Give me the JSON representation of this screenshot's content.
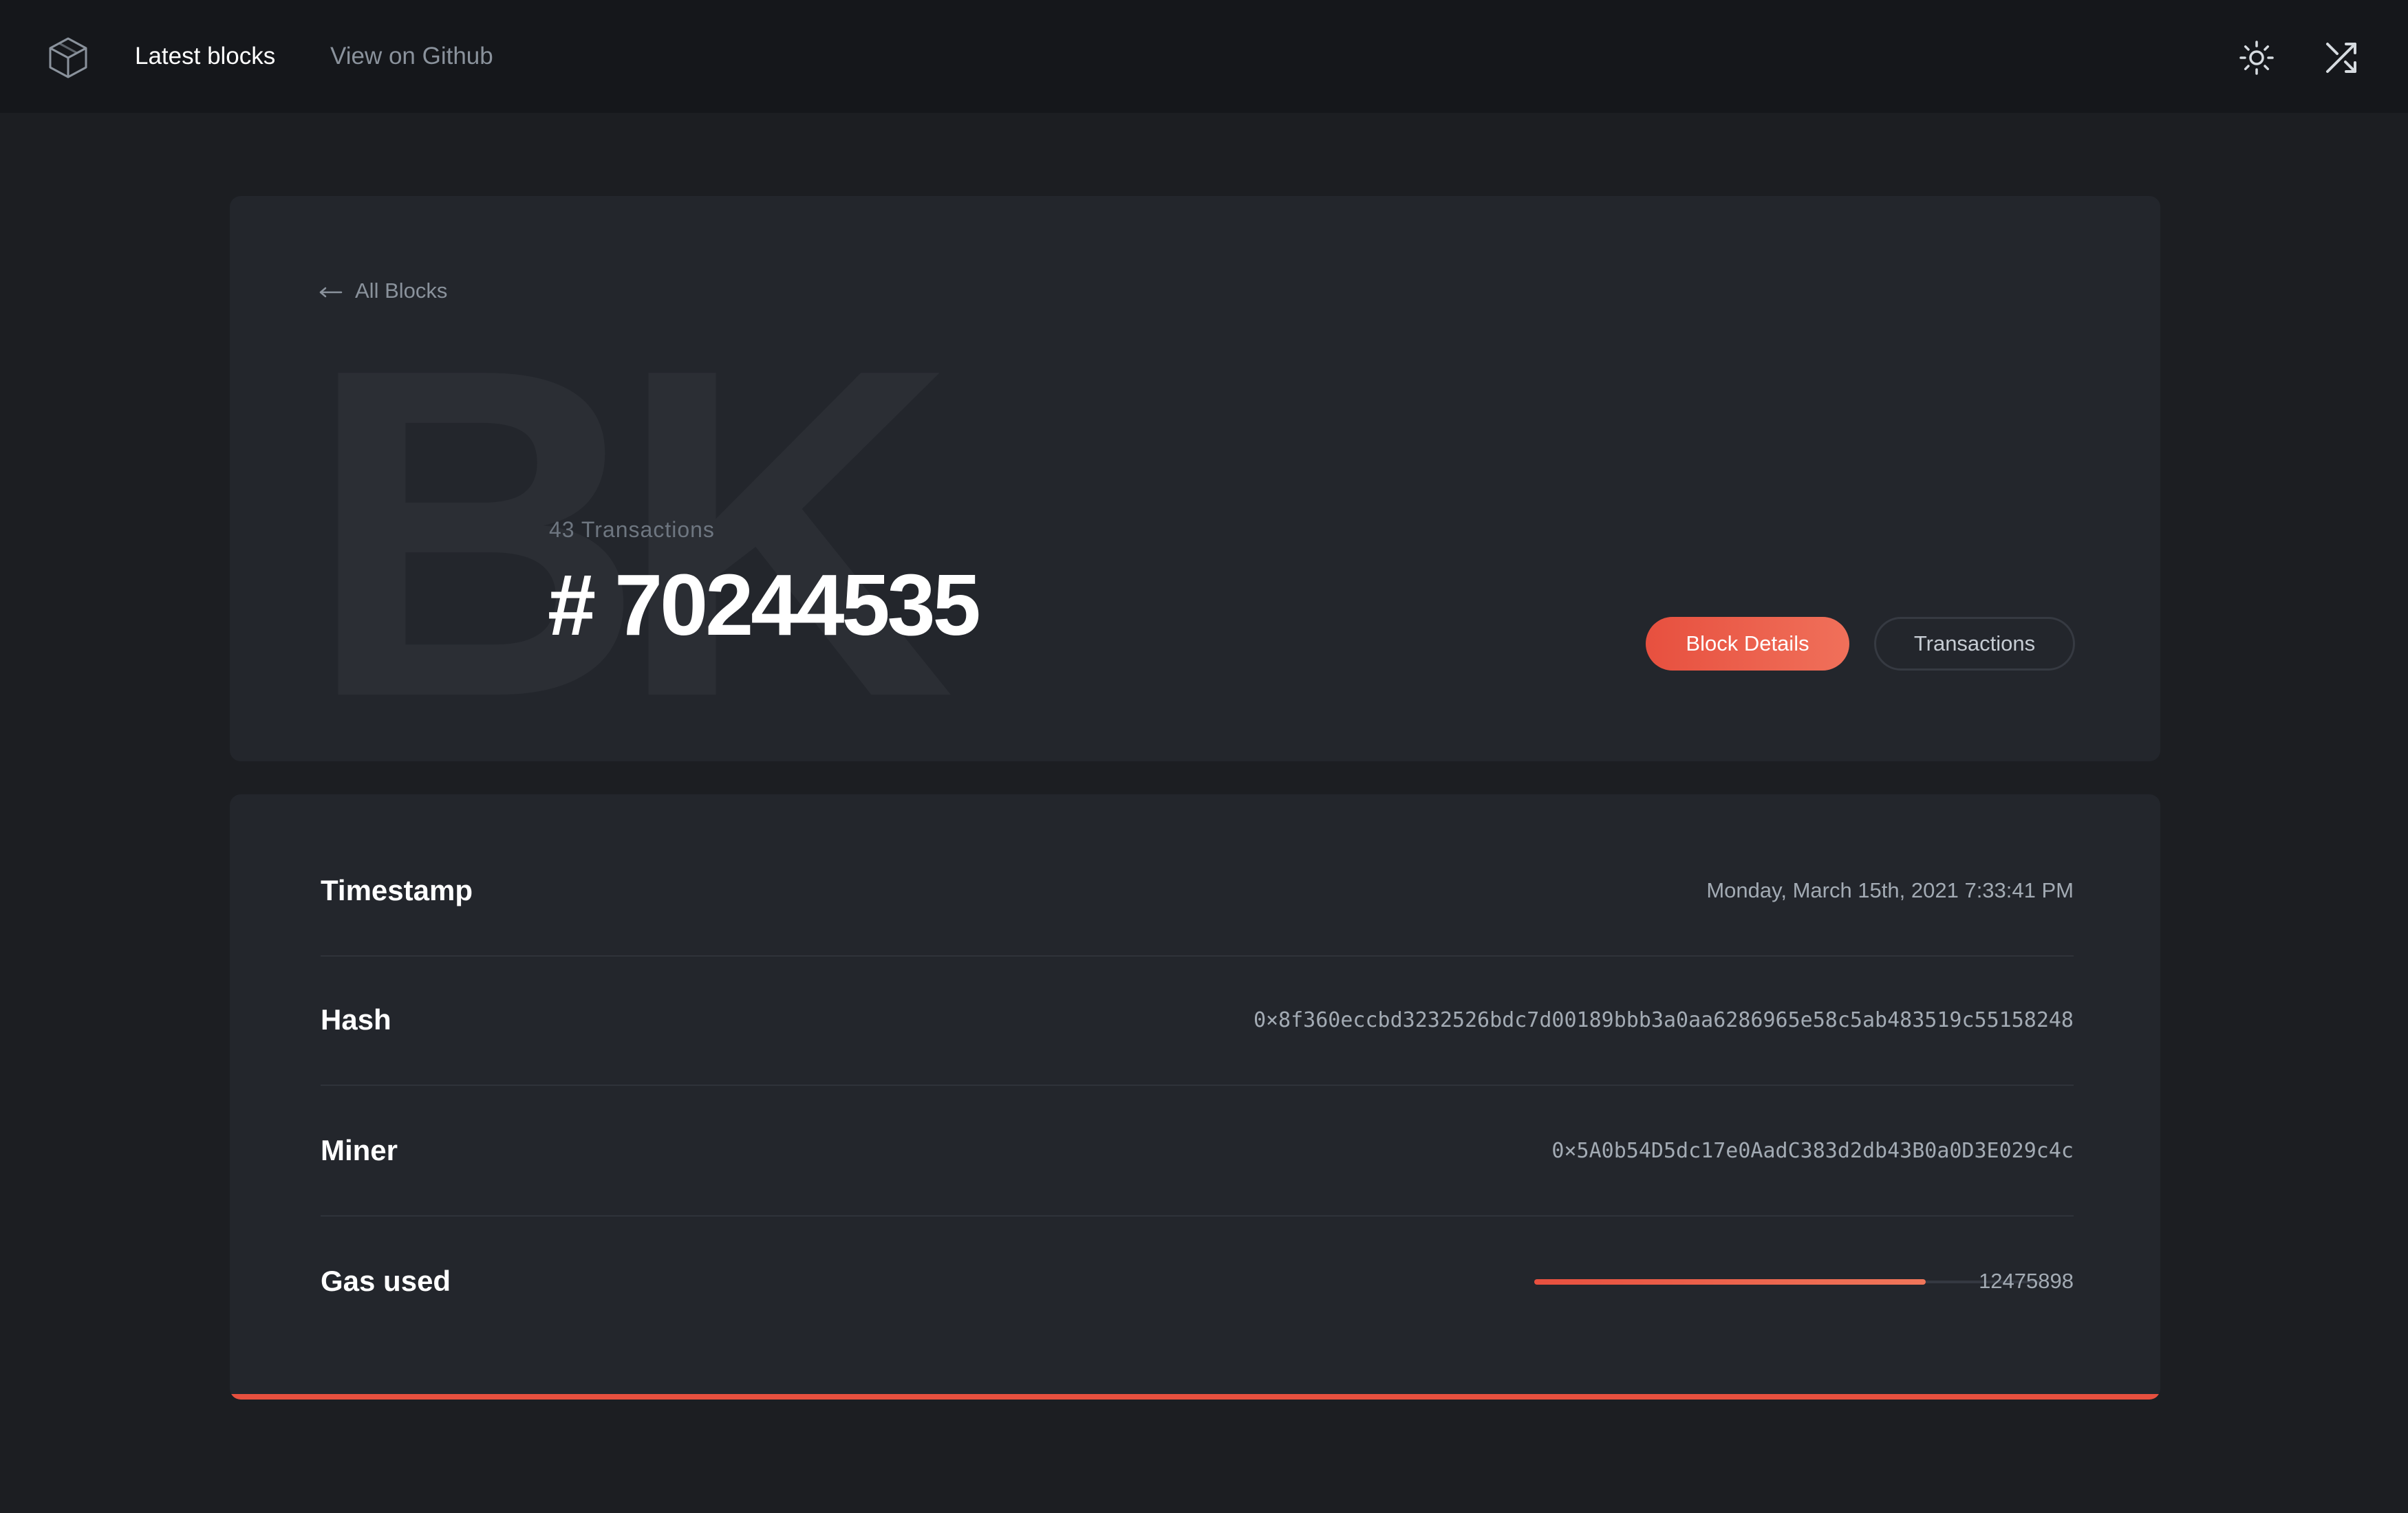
{
  "nav": {
    "latest_blocks": "Latest blocks",
    "view_on_github": "View on Github",
    "icons": [
      "cube-logo-icon",
      "sun-icon",
      "shuffle-icon"
    ]
  },
  "header": {
    "back_label": "All Blocks",
    "bg_letters": "BK",
    "transactions_count": "43 Transactions",
    "block_number": "# 70244535",
    "tabs": {
      "block_details": "Block Details",
      "transactions": "Transactions"
    }
  },
  "details": {
    "timestamp": {
      "label": "Timestamp",
      "value": "Monday, March 15th, 2021 7:33:41 PM"
    },
    "hash": {
      "label": "Hash",
      "value": "0×8f360eccbd3232526bdc7d00189bbb3a0aa6286965e58c5ab483519c55158248"
    },
    "miner": {
      "label": "Miner",
      "value": "0×5A0b54D5dc17e0AadC383d2db43B0a0D3E029c4c"
    },
    "gas_used": {
      "label": "Gas used",
      "value": "12475898",
      "fraction": 0.775
    }
  },
  "colors": {
    "background": "#1c1e22",
    "topbar": "#15171b",
    "card": "#23262c",
    "accent": "#e7503f",
    "muted_text": "#8a929c"
  }
}
